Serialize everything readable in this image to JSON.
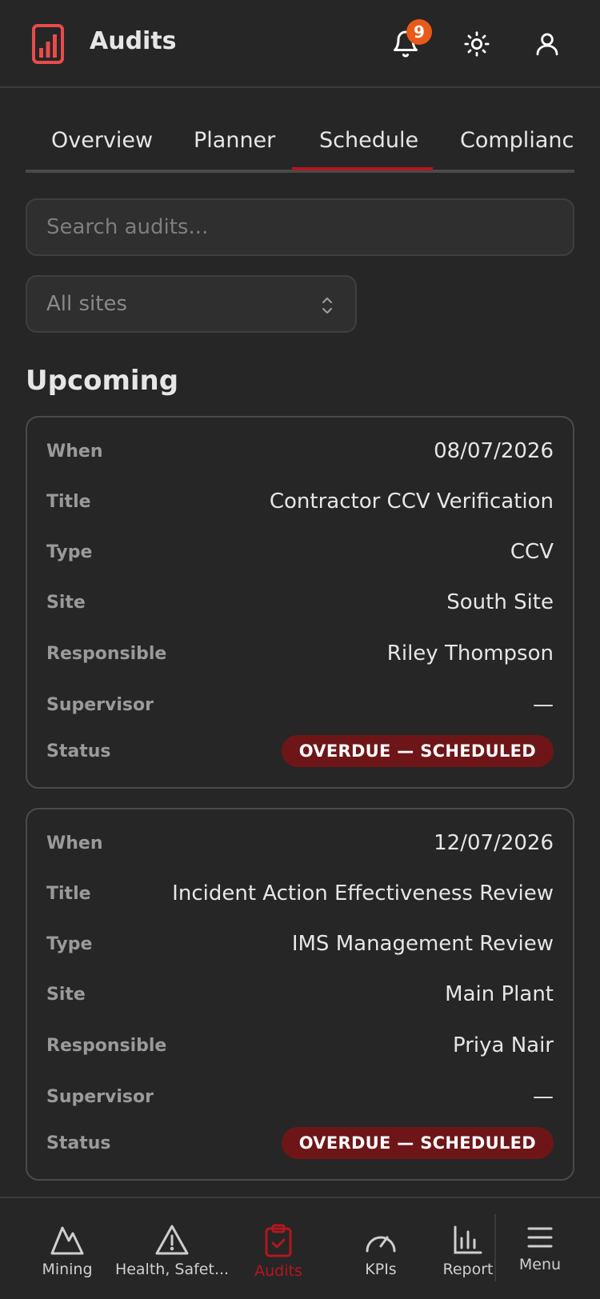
{
  "header": {
    "title": "Audits",
    "notification_count": "9",
    "colors": {
      "accent": "#b3171f",
      "badge": "#e8591a",
      "logo": "#e84b4b"
    }
  },
  "tabs": [
    {
      "label": "Overview"
    },
    {
      "label": "Planner"
    },
    {
      "label": "Schedule",
      "active": true
    },
    {
      "label": "Compliance"
    }
  ],
  "search": {
    "placeholder": "Search audits...",
    "value": ""
  },
  "site_filter": {
    "selected": "All sites"
  },
  "section": {
    "title": "Upcoming"
  },
  "audits": [
    {
      "labels": {
        "when": "When",
        "title": "Title",
        "type": "Type",
        "site": "Site",
        "responsible": "Responsible",
        "supervisor": "Supervisor",
        "status": "Status"
      },
      "when": "08/07/2026",
      "title": "Contractor CCV Verification",
      "type": "CCV",
      "site": "South Site",
      "responsible": "Riley Thompson",
      "supervisor": "—",
      "status": "OVERDUE — SCHEDULED"
    },
    {
      "labels": {
        "when": "When",
        "title": "Title",
        "type": "Type",
        "site": "Site",
        "responsible": "Responsible",
        "supervisor": "Supervisor",
        "status": "Status"
      },
      "when": "12/07/2026",
      "title": "Incident Action Effectiveness Review",
      "type": "IMS Management Review",
      "site": "Main Plant",
      "responsible": "Priya Nair",
      "supervisor": "—",
      "status": "OVERDUE — SCHEDULED"
    }
  ],
  "bottom_nav": [
    {
      "label": "Mining",
      "icon": "mountain-icon"
    },
    {
      "label": "Health, Safet...",
      "icon": "warning-icon"
    },
    {
      "label": "Audits",
      "icon": "clipboard-check-icon",
      "active": true
    },
    {
      "label": "KPIs",
      "icon": "gauge-icon"
    },
    {
      "label": "Report",
      "icon": "bar-chart-icon"
    },
    {
      "label": "Menu",
      "icon": "menu-icon"
    }
  ]
}
